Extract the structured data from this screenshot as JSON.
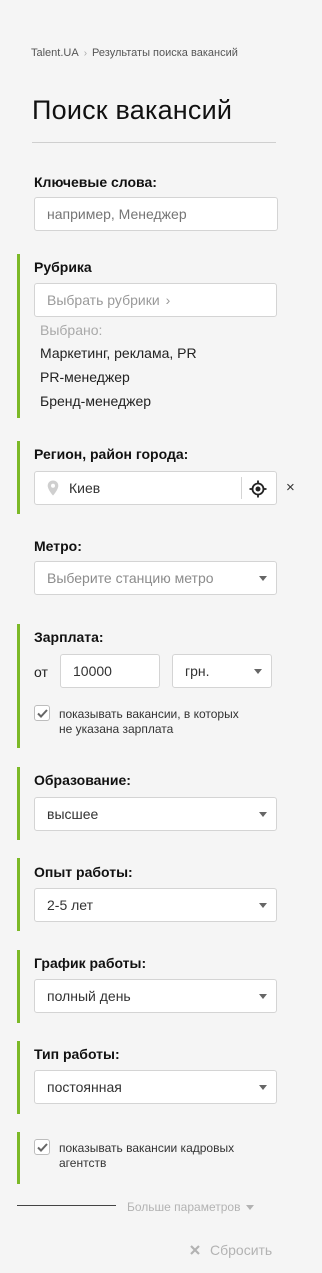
{
  "breadcrumb": {
    "home": "Talent.UA",
    "current": "Результаты поиска вакансий"
  },
  "page_title": "Поиск вакансий",
  "keywords": {
    "label": "Ключевые слова:",
    "placeholder": "например, Менеджер"
  },
  "rubric": {
    "label": "Рубрика",
    "placeholder": "Выбрать рубрики",
    "selected_label": "Выбрано:",
    "selected": [
      "Маркетинг, реклама, PR",
      "PR-менеджер",
      "Бренд-менеджер"
    ]
  },
  "region": {
    "label": "Регион, район города:",
    "value": "Киев",
    "clear": "×"
  },
  "metro": {
    "label": "Метро:",
    "placeholder": "Выберите станцию метро"
  },
  "salary": {
    "label": "Зарплата:",
    "from_label": "от",
    "from_value": "10000",
    "currency": "грн.",
    "show_unspecified_checked": true,
    "show_unspecified_line1": "показывать вакансии, в которых",
    "show_unspecified_line2": "не указана зарплата"
  },
  "education": {
    "label": "Образование:",
    "value": "высшее"
  },
  "experience": {
    "label": "Опыт работы:",
    "value": "2-5 лет"
  },
  "schedule": {
    "label": "График работы:",
    "value": "полный день"
  },
  "job_type": {
    "label": "Тип работы:",
    "value": "постоянная"
  },
  "agencies": {
    "checked": true,
    "line1": "показывать вакансии кадровых",
    "line2": "агентств"
  },
  "more_params": "Больше параметров",
  "reset": "Сбросить",
  "colors": {
    "accent": "#7cb928",
    "muted": "#b3b3b3"
  }
}
